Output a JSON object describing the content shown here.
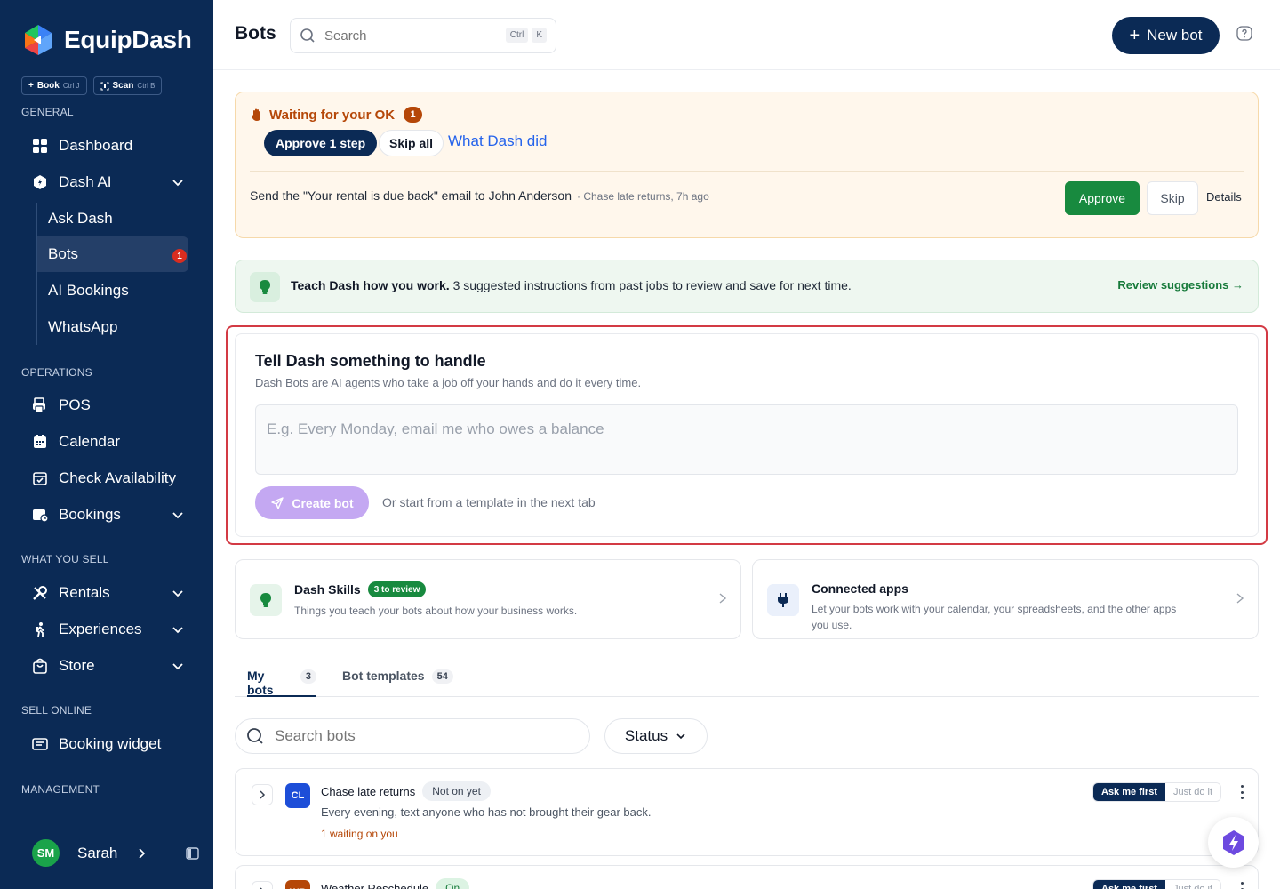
{
  "app": {
    "name": "EquipDash",
    "quick_actions": [
      {
        "label": "Book",
        "shortcut": "Ctrl J"
      },
      {
        "label": "Scan",
        "shortcut": "Ctrl B"
      }
    ]
  },
  "sidebar": {
    "sections": {
      "general": "GENERAL",
      "operations": "OPERATIONS",
      "what_you_sell": "WHAT YOU SELL",
      "sell_online": "SELL ONLINE",
      "management": "MANAGEMENT"
    },
    "items": {
      "dashboard": "Dashboard",
      "dash_ai": "Dash AI",
      "ask_dash": "Ask Dash",
      "bots": "Bots",
      "bots_badge": "1",
      "ai_bookings": "AI Bookings",
      "whatsapp": "WhatsApp",
      "pos": "POS",
      "calendar": "Calendar",
      "check_availability": "Check Availability",
      "bookings": "Bookings",
      "rentals": "Rentals",
      "experiences": "Experiences",
      "store": "Store",
      "booking_widget": "Booking widget"
    },
    "user": {
      "initials": "SM",
      "name": "Sarah"
    }
  },
  "header": {
    "title": "Bots",
    "search_placeholder": "Search",
    "search_shortcut": [
      "Ctrl",
      "K"
    ],
    "new_bot_label": "New bot"
  },
  "waiting": {
    "title": "Waiting for your OK",
    "count": "1",
    "approve_step_label": "Approve 1 step",
    "skip_all_label": "Skip all",
    "what_did_label": "What Dash did",
    "item_text": "Send the \"Your rental is due back\" email to John Anderson",
    "item_meta": "· Chase late returns, 7h ago",
    "approve_label": "Approve",
    "skip_label": "Skip",
    "details_label": "Details"
  },
  "teach": {
    "bold": "Teach Dash how you work.",
    "text": "3 suggested instructions from past jobs to review and save for next time.",
    "link": "Review suggestions →"
  },
  "create": {
    "title": "Tell Dash something to handle",
    "subtitle": "Dash Bots are AI agents who take a job off your hands and do it every time.",
    "placeholder": "E.g. Every Monday, email me who owes a balance",
    "button_label": "Create bot",
    "or_text": "Or start from a template in the next tab"
  },
  "cards": {
    "skills": {
      "title": "Dash Skills",
      "badge": "3 to review",
      "subtitle": "Things you teach your bots about how your business works."
    },
    "apps": {
      "title": "Connected apps",
      "subtitle_1": "Let your bots work with your calendar, your spreadsheets, and the other apps",
      "subtitle_2": "you use."
    }
  },
  "tabs": [
    {
      "label": "My bots",
      "count": "3"
    },
    {
      "label": "Bot templates",
      "count": "54"
    }
  ],
  "bot_list": {
    "search_placeholder": "Search bots",
    "status_label": "Status",
    "rows": [
      {
        "initials": "CL",
        "name": "Chase late returns",
        "status": "Not on yet",
        "description": "Every evening, text anyone who has not brought their gear back.",
        "waiting": "1 waiting on you",
        "mode_a": "Ask me first",
        "mode_b": "Just do it",
        "avatar_color": "#1d4ed8"
      },
      {
        "initials": "WR",
        "name": "Weather Reschedule",
        "status": "On",
        "mode_a": "Ask me first",
        "mode_b": "Just do it",
        "avatar_color": "#b54708"
      }
    ]
  },
  "colors": {
    "sidebar_bg": "#0b2a55",
    "accent_navy": "#0b2a55",
    "approve_green": "#188a3f",
    "warning_orange": "#b54708",
    "create_purple": "#c4a8f2",
    "highlight_red": "#d33a44"
  }
}
